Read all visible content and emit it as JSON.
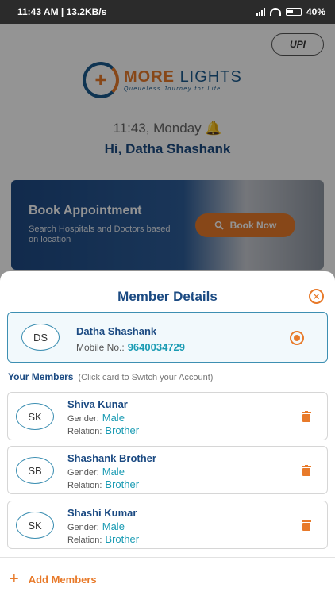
{
  "status_bar": {
    "time_speed": "11:43 AM | 13.2KB/s",
    "battery": "40%"
  },
  "background": {
    "upi_label": "UPI",
    "logo_text_1": "MORE",
    "logo_text_2": "LIGHTS",
    "logo_tagline": "Queueless Journey for Life",
    "time_day": "11:43, Monday",
    "greeting": "Hi, Datha Shashank",
    "banner_title": "Book Appointment",
    "banner_subtitle": "Search Hospitals and Doctors based on location",
    "book_now": "Book Now"
  },
  "sheet": {
    "title": "Member Details",
    "primary": {
      "initials": "DS",
      "name": "Datha Shashank",
      "mobile_label": "Mobile No.:",
      "mobile": "9640034729"
    },
    "members_heading": "Your Members",
    "members_hint": "(Click card to Switch your Account)",
    "gender_label": "Gender:",
    "relation_label": "Relation:",
    "members": [
      {
        "initials": "SK",
        "name": "Shiva Kunar",
        "gender": "Male",
        "relation": "Brother"
      },
      {
        "initials": "SB",
        "name": "Shashank Brother",
        "gender": "Male",
        "relation": "Brother"
      },
      {
        "initials": "SK",
        "name": "Shashi Kumar",
        "gender": "Male",
        "relation": "Brother"
      }
    ],
    "add_members": "Add Members"
  },
  "colors": {
    "accent": "#e87a2a",
    "primary": "#1b4a82",
    "teal": "#1a9bb3"
  }
}
